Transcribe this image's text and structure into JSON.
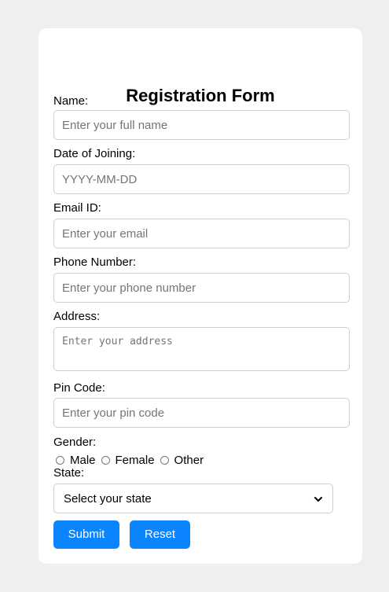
{
  "form": {
    "title": "Registration Form",
    "fields": {
      "name": {
        "label": "Name:",
        "placeholder": "Enter your full name"
      },
      "doj": {
        "label": "Date of Joining:",
        "placeholder": "YYYY-MM-DD"
      },
      "email": {
        "label": "Email ID:",
        "placeholder": "Enter your email"
      },
      "phone": {
        "label": "Phone Number:",
        "placeholder": "Enter your phone number"
      },
      "address": {
        "label": "Address:",
        "placeholder": "Enter your address"
      },
      "pincode": {
        "label": "Pin Code:",
        "placeholder": "Enter your pin code"
      }
    },
    "gender": {
      "label": "Gender:",
      "options": [
        "Male",
        "Female",
        "Other"
      ]
    },
    "state": {
      "label": "State:",
      "selected": "Select your state"
    },
    "buttons": {
      "submit": "Submit",
      "reset": "Reset"
    }
  },
  "colors": {
    "page_background": "#efefef",
    "card_background": "#ffffff",
    "button_accent": "#0a84ff"
  },
  "icons": {
    "select_arrow": "chevron-down-icon"
  }
}
